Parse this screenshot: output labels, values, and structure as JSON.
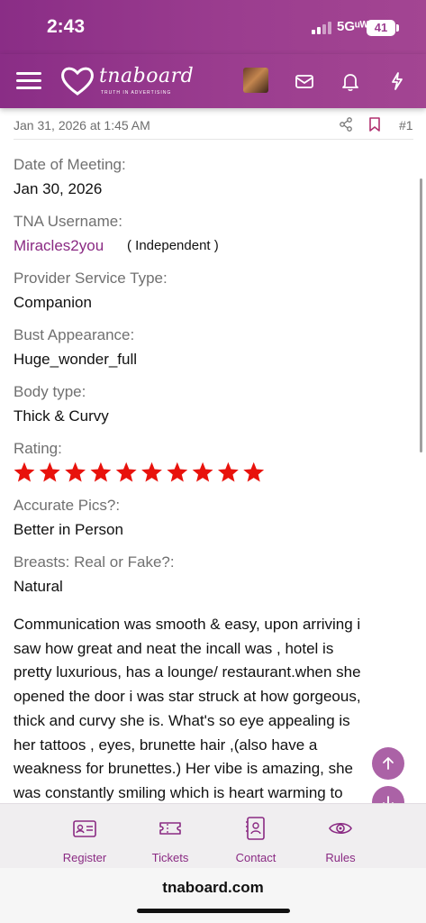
{
  "status_bar": {
    "time": "2:43",
    "network": "5Gᵘᵂ",
    "battery": "41"
  },
  "header": {
    "logo_text": "tnaboard",
    "logo_tagline": "TRUTH IN ADVERTISING",
    "icons": [
      "menu-icon",
      "avatar",
      "mail-icon",
      "bell-icon",
      "bolt-icon"
    ]
  },
  "post": {
    "date": "Jan 31, 2026 at 1:45 AM",
    "number": "#1",
    "fields": {
      "date_of_meeting": {
        "label": "Date of Meeting:",
        "value": "Jan 30, 2026"
      },
      "tna_username": {
        "label": "TNA Username:",
        "value": "Miracles2you",
        "tag": "( Independent )"
      },
      "provider_service_type": {
        "label": "Provider Service Type:",
        "value": "Companion"
      },
      "bust_appearance": {
        "label": "Bust Appearance:",
        "value": "Huge_wonder_full"
      },
      "body_type": {
        "label": "Body type:",
        "value": "Thick & Curvy"
      },
      "rating": {
        "label": "Rating:",
        "stars": 10,
        "max": 10,
        "color": "#e8120c"
      },
      "accurate_pics": {
        "label": "Accurate Pics?:",
        "value": "Better in Person"
      },
      "breasts": {
        "label": "Breasts: Real or Fake?:",
        "value": "Natural"
      }
    },
    "body_lines": [
      "Communication was smooth & easy, upon arriving i",
      "saw how great and neat the incall was , hotel is",
      "pretty luxurious, has a lounge/ restaurant.when she",
      "opened the door i was star struck at how gorgeous,",
      "thick and curvy she is. What's so eye appealing is",
      "her tattoos , eyes, brunette hair ,(also have a",
      "weakness for brunettes.) Her vibe is amazing, she",
      "was constantly smiling which is heart warming to"
    ]
  },
  "bottom_nav": {
    "items": [
      {
        "label": "Register",
        "icon": "id-card-icon"
      },
      {
        "label": "Tickets",
        "icon": "ticket-icon"
      },
      {
        "label": "Contact",
        "icon": "contact-icon"
      },
      {
        "label": "Rules",
        "icon": "eye-icon"
      }
    ]
  },
  "browser": {
    "url": "tnaboard.com"
  },
  "colors": {
    "brand": "#9b3d8f",
    "link": "#8a2a83",
    "star": "#e8120c"
  }
}
